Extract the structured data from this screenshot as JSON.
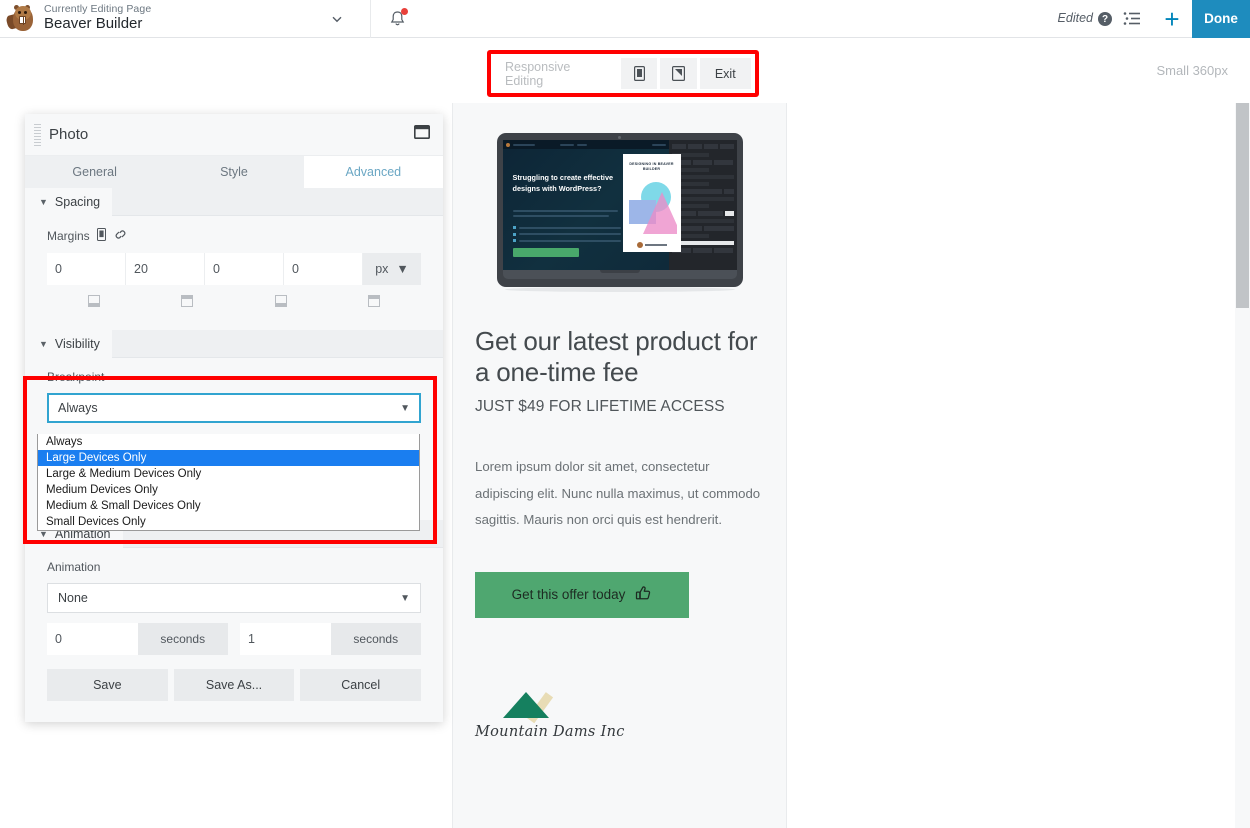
{
  "adminbar": {
    "logo_icon": "beaver-logo",
    "eyebrow": "Currently Editing Page",
    "title": "Beaver Builder",
    "caret_icon": "chevron-down-icon",
    "bell_icon": "bell-icon",
    "edited_label": "Edited",
    "help_icon": "question-mark-icon",
    "outline_icon": "outline-list-icon",
    "add_icon": "plus-icon",
    "done_label": "Done"
  },
  "responsive": {
    "label": "Responsive Editing",
    "mobile_icon": "mobile-device-icon",
    "tablet_icon": "tablet-device-icon",
    "exit_label": "Exit",
    "size_label": "Small 360px",
    "annotation_color": "#ff0000"
  },
  "panel": {
    "title": "Photo",
    "window_icon": "window-restore-icon",
    "drag_icon": "drag-handle-icon",
    "tabs": [
      {
        "label": "General",
        "active": false
      },
      {
        "label": "Style",
        "active": false
      },
      {
        "label": "Advanced",
        "active": true
      }
    ],
    "spacing": {
      "section_label": "Spacing",
      "margins_label": "Margins",
      "responsive_icon": "mobile-device-icon",
      "link_icon": "link-chain-icon",
      "values": [
        "0",
        "20",
        "0",
        "0"
      ],
      "unit": "px",
      "unit_caret_icon": "chevron-down-icon",
      "side_icons": [
        "margin-top-icon",
        "margin-right-icon",
        "margin-bottom-icon",
        "margin-left-icon"
      ]
    },
    "visibility": {
      "section_label": "Visibility",
      "breakpoint_label": "Breakpoint",
      "breakpoint_value": "Always",
      "caret_icon": "chevron-down-icon",
      "options": [
        {
          "label": "Always",
          "selected": false
        },
        {
          "label": "Large Devices Only",
          "selected": true
        },
        {
          "label": "Large & Medium Devices Only",
          "selected": false
        },
        {
          "label": "Medium Devices Only",
          "selected": false
        },
        {
          "label": "Medium & Small Devices Only",
          "selected": false
        },
        {
          "label": "Small Devices Only",
          "selected": false
        }
      ],
      "highlight_color": "#1a7ef0"
    },
    "animation": {
      "section_label": "Animation",
      "label": "Animation",
      "value": "None",
      "caret_icon": "chevron-down-icon",
      "delay_value": "0",
      "delay_unit": "seconds",
      "duration_value": "1",
      "duration_unit": "seconds"
    },
    "footer": {
      "save_label": "Save",
      "save_as_label": "Save As...",
      "cancel_label": "Cancel"
    }
  },
  "preview": {
    "laptop": {
      "headline": "Struggling to create effective designs with WordPress?",
      "book_title": "DESIGNING IN BEAVER BUILDER"
    },
    "h1": "Get our latest product for a one-time fee",
    "subhead": "JUST $49 FOR LIFETIME ACCESS",
    "body": "Lorem ipsum dolor sit amet, consectetur adipiscing elit. Nunc nulla maximus, ut commodo sagittis. Mauris non orci quis est hendrerit.",
    "cta_label": "Get this offer today",
    "cta_icon": "thumbs-up-icon",
    "cta_color": "#4fa770",
    "logo_icon": "mountain-logo-icon",
    "logo_text": "Mountain Dams Inc"
  },
  "scrollbar": {
    "up_icon": "chevron-up-icon",
    "down_icon": "chevron-down-icon"
  }
}
